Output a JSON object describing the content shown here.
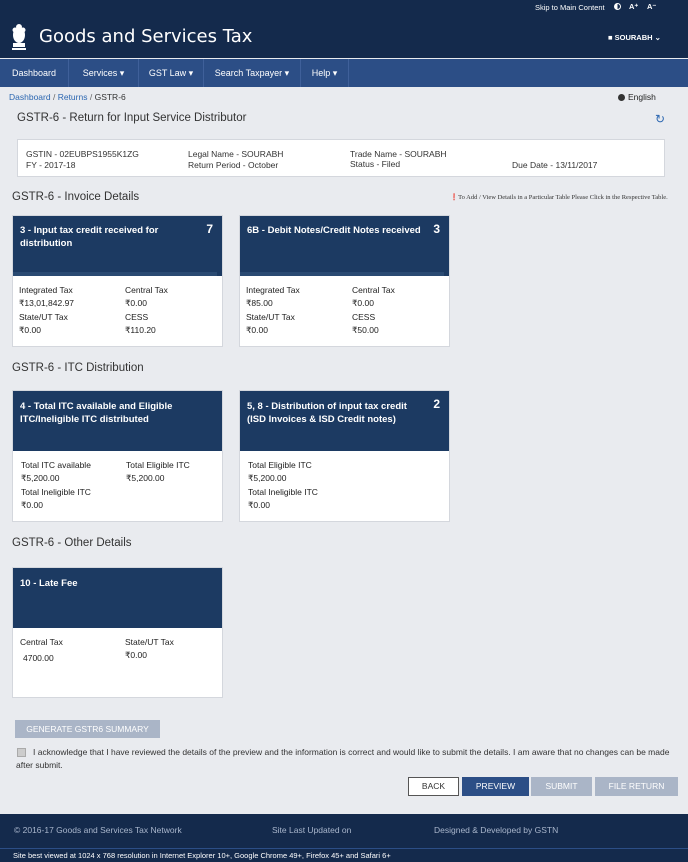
{
  "topbar": {
    "skip": "Skip to Main Content",
    "font_plus": "A⁺",
    "font_minus": "A⁻"
  },
  "header": {
    "title": "Goods and Services Tax",
    "user": "SOURABH"
  },
  "nav": [
    "Dashboard",
    "Services ▾",
    "GST Law ▾",
    "Search Taxpayer ▾",
    "Help ▾"
  ],
  "breadcrumb": {
    "dashboard": "Dashboard",
    "returns": "Returns",
    "current": "GSTR-6"
  },
  "language": "English",
  "page_title": "GSTR-6 - Return for Input Service Distributor",
  "info": {
    "gstin": "GSTIN - 02EUBPS1955K1ZG",
    "fy": "FY - 2017-18",
    "legal_name": "Legal Name - SOURABH",
    "return_period": "Return Period - October",
    "trade_name": "Trade Name - SOURABH",
    "status": "Status - Filed",
    "due_date": "Due Date - 13/11/2017"
  },
  "sections": {
    "invoice": "GSTR-6 - Invoice Details",
    "itc": "GSTR-6 - ITC Distribution",
    "other": "GSTR-6 - Other Details"
  },
  "note": "To Add / View Details in a Particular Table Please Click in the Respective Table.",
  "cards": {
    "c3": {
      "title": "3 - Input tax credit received for distribution",
      "count": "7",
      "l1": "Integrated Tax",
      "v1": "₹13,01,842.97",
      "l2": "Central Tax",
      "v2": "₹0.00",
      "l3": "State/UT Tax",
      "v3": "₹0.00",
      "l4": "CESS",
      "v4": "₹110.20"
    },
    "c6b": {
      "title": "6B - Debit Notes/Credit Notes received",
      "count": "3",
      "l1": "Integrated Tax",
      "v1": "₹85.00",
      "l2": "Central Tax",
      "v2": "₹0.00",
      "l3": "State/UT Tax",
      "v3": "₹0.00",
      "l4": "CESS",
      "v4": "₹50.00"
    },
    "c4": {
      "title": "4 - Total ITC available and Eligible ITC/Ineligible ITC distributed",
      "count": "",
      "l1": "Total ITC available",
      "v1": "₹5,200.00",
      "l2": "Total Eligible ITC",
      "v2": "₹5,200.00",
      "l3": "Total Ineligible ITC",
      "v3": "₹0.00"
    },
    "c58": {
      "title": "5, 8 - Distribution of input tax credit (ISD Invoices & ISD Credit notes)",
      "count": "2",
      "l1": "Total Eligible ITC",
      "v1": "₹5,200.00",
      "l2": "Total Ineligible ITC",
      "v2": "₹0.00"
    },
    "c10": {
      "title": "10 - Late Fee",
      "count": "",
      "l1": "Central Tax",
      "v1": "4700.00",
      "l2": "State/UT Tax",
      "v2": "₹0.00"
    }
  },
  "generate_summary": "GENERATE GSTR6 SUMMARY",
  "acknowledge": "I acknowledge that I have reviewed the details of the preview and the information is correct and would like to submit the details. I am aware that no changes can be made after submit.",
  "buttons": {
    "back": "BACK",
    "preview": "PREVIEW",
    "submit": "SUBMIT",
    "file_return": "FILE RETURN"
  },
  "footer": {
    "copyright": "© 2016-17 Goods and Services Tax Network",
    "updated": "Site Last Updated on",
    "designed": "Designed & Developed by GSTN",
    "best_view": "Site best viewed at 1024 x 768 resolution in Internet Explorer 10+, Google Chrome 49+, Firefox 45+ and Safari 6+"
  },
  "colors": {
    "header": "#142a4c",
    "nav": "#2c4e86",
    "card_header": "#1c3a62",
    "primary_button": "#2c4e86"
  }
}
